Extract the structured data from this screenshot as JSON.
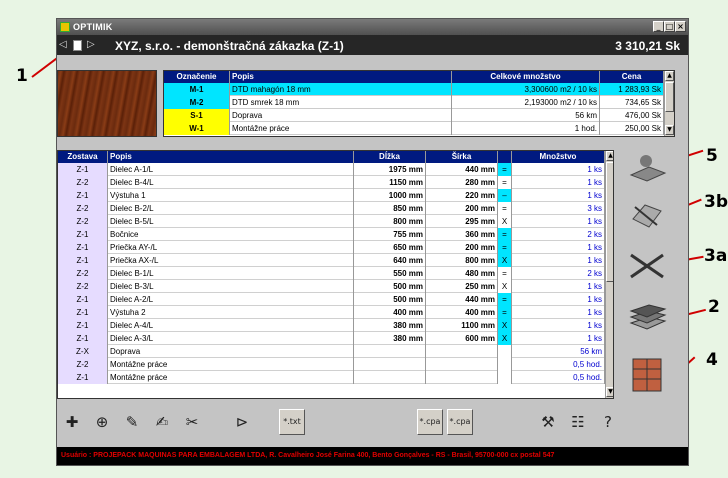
{
  "app": {
    "title": "OPTIMIK"
  },
  "header": {
    "title": "XYZ, s.r.o. - demonštračná zákazka  (Z-1)",
    "total_price": "3 310,21 Sk"
  },
  "window_buttons": {
    "minimize": "_",
    "maximize": "□",
    "close": "×"
  },
  "callouts": [
    "1",
    "5",
    "3b",
    "3a",
    "2",
    "4"
  ],
  "materials": {
    "columns": [
      "Označenie",
      "Popis",
      "Celkové množstvo",
      "Cena"
    ],
    "rows": [
      {
        "code": "M-1",
        "desc": "DTD mahagón 18 mm",
        "qty": "3,300600 m2 / 10 ks",
        "price": "1 283,93 Sk",
        "color": "#00e5ff"
      },
      {
        "code": "M-2",
        "desc": "DTD smrek 18 mm",
        "qty": "2,193000 m2 / 10 ks",
        "price": "734,65 Sk",
        "color": "#00e5ff"
      },
      {
        "code": "S-1",
        "desc": "Doprava",
        "qty": "56 km",
        "price": "476,00 Sk",
        "color": "#ffff00"
      },
      {
        "code": "W-1",
        "desc": "Montážne práce",
        "qty": "1 hod.",
        "price": "250,00 Sk",
        "color": "#ffff00"
      }
    ]
  },
  "parts": {
    "columns": [
      "Zostava",
      "Popis",
      "Dĺžka",
      "Šírka",
      "",
      "Množstvo"
    ],
    "rows": [
      {
        "zostava": "Z-1",
        "popis": "Dielec A-1/L",
        "dlzka": "1975 mm",
        "sirka": "440 mm",
        "mark": "=",
        "mark_bg": "#00e5ff",
        "mnozstvo": "1 ks"
      },
      {
        "zostava": "Z-2",
        "popis": "Dielec B-4/L",
        "dlzka": "1150 mm",
        "sirka": "280 mm",
        "mark": "=",
        "mark_bg": "#ffffff",
        "mnozstvo": "1 ks"
      },
      {
        "zostava": "Z-1",
        "popis": "Výstuha 1",
        "dlzka": "1000 mm",
        "sirka": "220 mm",
        "mark": "–",
        "mark_bg": "#00e5ff",
        "mnozstvo": "1 ks"
      },
      {
        "zostava": "Z-2",
        "popis": "Dielec B-2/L",
        "dlzka": "850 mm",
        "sirka": "200 mm",
        "mark": "=",
        "mark_bg": "#ffffff",
        "mnozstvo": "3 ks"
      },
      {
        "zostava": "Z-2",
        "popis": "Dielec B-5/L",
        "dlzka": "800 mm",
        "sirka": "295 mm",
        "mark": "X",
        "mark_bg": "#ffffff",
        "mnozstvo": "1 ks"
      },
      {
        "zostava": "Z-1",
        "popis": "Bočnice",
        "dlzka": "755 mm",
        "sirka": "360 mm",
        "mark": "=",
        "mark_bg": "#00e5ff",
        "mnozstvo": "2 ks"
      },
      {
        "zostava": "Z-1",
        "popis": "Priečka AY-/L",
        "dlzka": "650 mm",
        "sirka": "200 mm",
        "mark": "=",
        "mark_bg": "#00e5ff",
        "mnozstvo": "1 ks"
      },
      {
        "zostava": "Z-1",
        "popis": "Priečka AX-/L",
        "dlzka": "640 mm",
        "sirka": "800 mm",
        "mark": "X",
        "mark_bg": "#00e5ff",
        "mnozstvo": "1 ks"
      },
      {
        "zostava": "Z-2",
        "popis": "Dielec B-1/L",
        "dlzka": "550 mm",
        "sirka": "480 mm",
        "mark": "=",
        "mark_bg": "#ffffff",
        "mnozstvo": "2 ks"
      },
      {
        "zostava": "Z-2",
        "popis": "Dielec B-3/L",
        "dlzka": "500 mm",
        "sirka": "250 mm",
        "mark": "X",
        "mark_bg": "#ffffff",
        "mnozstvo": "1 ks"
      },
      {
        "zostava": "Z-1",
        "popis": "Dielec A-2/L",
        "dlzka": "500 mm",
        "sirka": "440 mm",
        "mark": "=",
        "mark_bg": "#00e5ff",
        "mnozstvo": "1 ks"
      },
      {
        "zostava": "Z-1",
        "popis": "Výstuha 2",
        "dlzka": "400 mm",
        "sirka": "400 mm",
        "mark": "=",
        "mark_bg": "#00e5ff",
        "mnozstvo": "1 ks"
      },
      {
        "zostava": "Z-1",
        "popis": "Dielec A-4/L",
        "dlzka": "380 mm",
        "sirka": "1100 mm",
        "mark": "X",
        "mark_bg": "#00e5ff",
        "mnozstvo": "1 ks"
      },
      {
        "zostava": "Z-1",
        "popis": "Dielec A-3/L",
        "dlzka": "380 mm",
        "sirka": "600 mm",
        "mark": "X",
        "mark_bg": "#00e5ff",
        "mnozstvo": "1 ks"
      },
      {
        "zostava": "Z-X",
        "popis": "Doprava",
        "dlzka": "",
        "sirka": "",
        "mark": "",
        "mark_bg": "#ffffff",
        "mnozstvo": "56 km"
      },
      {
        "zostava": "Z-2",
        "popis": "Montážne práce",
        "dlzka": "",
        "sirka": "",
        "mark": "",
        "mark_bg": "#ffffff",
        "mnozstvo": "0,5 hod."
      },
      {
        "zostava": "Z-1",
        "popis": "Montážne práce",
        "dlzka": "",
        "sirka": "",
        "mark": "",
        "mark_bg": "#ffffff",
        "mnozstvo": "0,5 hod."
      }
    ]
  },
  "toolbar": {
    "export_txt_label": "*.txt",
    "import_cpa_label": "*.cpa",
    "export_cpa_label": "*.cpa"
  },
  "status": "Usuário : PROJEPACK MAQUINAS PARA EMBALAGEM LTDA, R. Cavalheiro José Farina 400, Bento Gonçalves - RS - Brasil, 95700-000  cx postal 547",
  "colors": {
    "header_bg": "#001a80",
    "cyan": "#00e5ff",
    "yellow": "#ffff00",
    "status_text": "#e00000",
    "zostava_bg": "#e6dcff"
  }
}
